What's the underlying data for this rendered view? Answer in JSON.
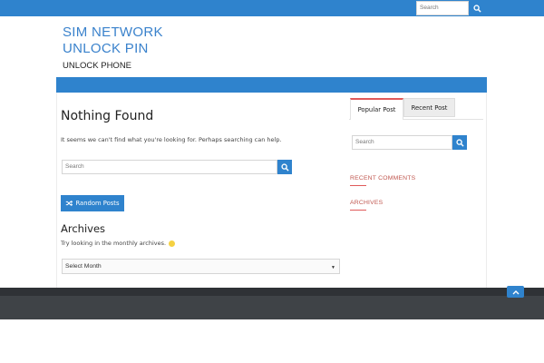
{
  "header": {
    "search_placeholder": "Search",
    "site_title": "SIM NETWORK UNLOCK PIN",
    "site_description": "UNLOCK PHONE"
  },
  "main": {
    "title": "Nothing Found",
    "message": "It seems we can't find what you're looking for. Perhaps searching can help.",
    "search_placeholder": "Search",
    "random_button_label": "Random Posts",
    "archives_title": "Archives",
    "archives_text": "Try looking in the monthly archives.",
    "month_select_value": "Select Month"
  },
  "sidebar": {
    "tabs": [
      {
        "label": "Popular Post",
        "active": true
      },
      {
        "label": "Recent Post",
        "active": false
      }
    ],
    "search_placeholder": "Search",
    "widgets": [
      {
        "title": "RECENT COMMENTS"
      },
      {
        "title": "ARCHIVES"
      }
    ]
  },
  "colors": {
    "brand_blue": "#2f83cd",
    "accent_red": "#e05a5a",
    "footer_dark": "#3f4347"
  },
  "icons": {
    "search": "search-icon",
    "shuffle": "shuffle-icon",
    "scroll_up": "chevron-up-icon"
  }
}
